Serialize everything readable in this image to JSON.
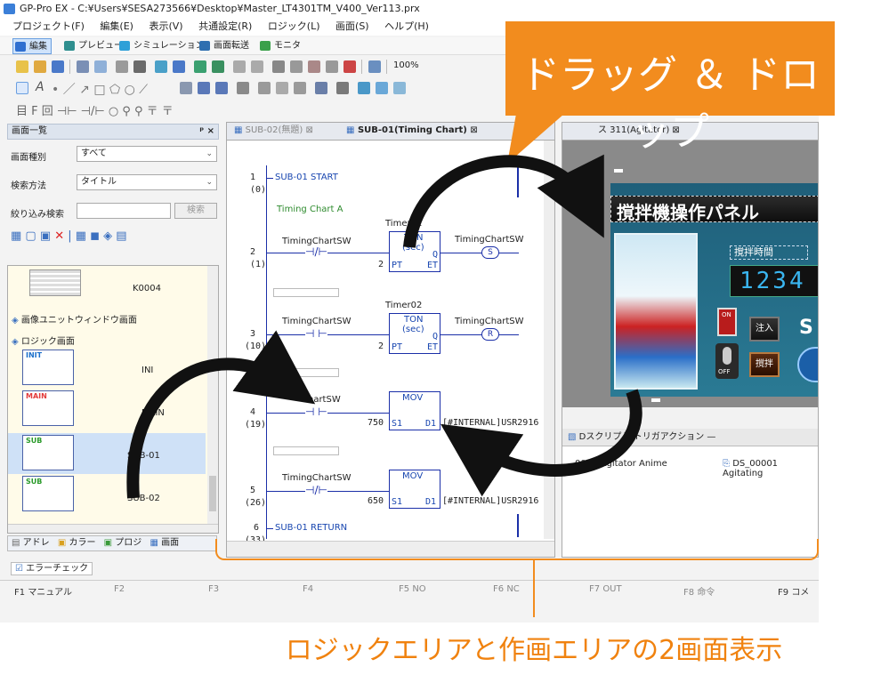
{
  "window": {
    "title": "GP-Pro EX - C:¥Users¥SESA273566¥Desktop¥Master_LT4301TM_V400_Ver113.prx"
  },
  "menu": [
    "プロジェクト(F)",
    "編集(E)",
    "表示(V)",
    "共通設定(R)",
    "ロジック(L)",
    "画面(S)",
    "ヘルプ(H)"
  ],
  "modes": [
    "編集",
    "プレビュー",
    "シミュレーション",
    "画面転送",
    "モニタ"
  ],
  "zoom": "100%",
  "screen_list": {
    "title": "画面一覧",
    "pin": "ᵖ ×",
    "type_label": "画面種別",
    "type_value": "すべて",
    "search_method_label": "検索方法",
    "search_method_value": "タイトル",
    "filter_label": "絞り込み検索",
    "search_button": "検索",
    "items": {
      "k0004": "K0004",
      "image_unit": "画像ユニットウィンドウ画面",
      "logic": "ロジック画面",
      "init_tag": "INIT",
      "init_name": "INI",
      "main_tag": "MAIN",
      "main_name": "MAIN",
      "sub1_tag": "SUB",
      "sub1_name": "SUB-01",
      "sub2_tag": "SUB",
      "sub2_name": "SUB-02"
    },
    "bottom_tabs": [
      "アドレ",
      "カラー",
      "プロジ",
      "画面"
    ]
  },
  "error_check": "エラーチェック",
  "tabs": {
    "tab1": "SUB-02(無題)",
    "tab2": "SUB-01(Timing Chart)",
    "tab3": "ス 311(Agitator)"
  },
  "ladder": {
    "rungs": [
      {
        "num": "1",
        "step": "(0)",
        "label": "SUB-01 START"
      },
      {
        "comment": "Timing Chart A"
      },
      {
        "num": "2",
        "step": "(1)",
        "contact": "TimingChartSW",
        "timer": "Timer01",
        "fb": "TON",
        "fb_sub": "(sec)",
        "pt": "PT",
        "q": "Q",
        "et": "ET",
        "preset": "2",
        "coil": "TimingChartSW",
        "coil_sym": "S"
      },
      {
        "num": "3",
        "step": "(10)",
        "contact": "TimingChartSW",
        "timer": "Timer02",
        "fb": "TON",
        "fb_sub": "(sec)",
        "pt": "PT",
        "q": "Q",
        "et": "ET",
        "preset": "2",
        "coil": "TimingChartSW",
        "coil_sym": "R"
      },
      {
        "num": "4",
        "step": "(19)",
        "contact": "ChartSW",
        "fb": "MOV",
        "s1": "S1",
        "d1": "D1",
        "value": "750",
        "dest": "[#INTERNAL]USR2916"
      },
      {
        "num": "5",
        "step": "(26)",
        "contact": "TimingChartSW",
        "fb": "MOV",
        "s1": "S1",
        "d1": "D1",
        "value": "650",
        "dest": "[#INTERNAL]USR2916"
      },
      {
        "num": "6",
        "step": "(33)",
        "label": "SUB-01 RETURN"
      }
    ]
  },
  "panel": {
    "title": "撹拌機操作パネル",
    "time_label": "撹拌時間",
    "time_value": "1234",
    "btn_inject": "注入",
    "btn_stir": "撹拌",
    "on": "ON",
    "off": "OFF",
    "s_label": "S"
  },
  "script_area": {
    "tab": "Dスクリプト/トリガアクション",
    "item1": "0000 Agitator Anime",
    "item2": "DS_00001 Agitating"
  },
  "fkeys": [
    {
      "key": "F1",
      "label": "マニュアル"
    },
    {
      "key": "F2",
      "label": ""
    },
    {
      "key": "F3",
      "label": ""
    },
    {
      "key": "F4",
      "label": ""
    },
    {
      "key": "F5",
      "label": "NO"
    },
    {
      "key": "F6",
      "label": "NC"
    },
    {
      "key": "F7",
      "label": "OUT"
    },
    {
      "key": "F8",
      "label": "命令"
    },
    {
      "key": "F9",
      "label": "コメ"
    }
  ],
  "callout": "ドラッグ ＆ ドロップ",
  "caption": "ロジックエリアと作画エリアの2画面表示",
  "colors": {
    "callout": "#f28c1e",
    "caption": "#f0820f",
    "ladder": "#1b2fa8"
  }
}
